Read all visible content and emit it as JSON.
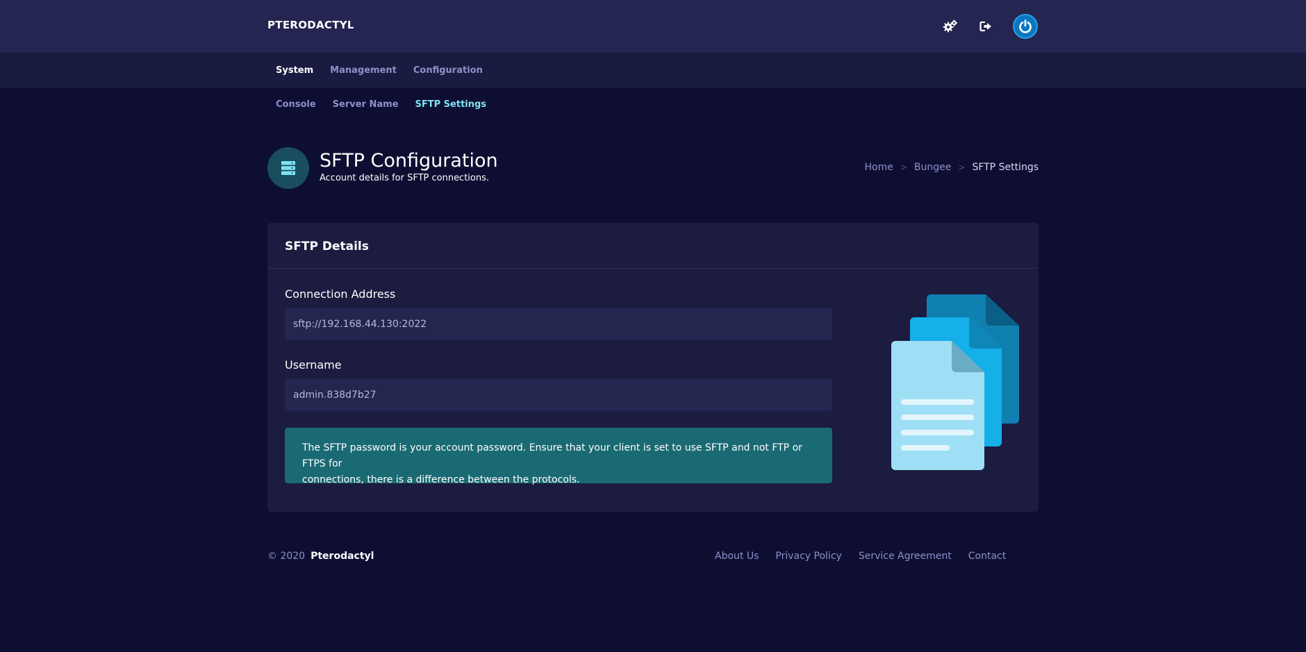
{
  "topbar": {
    "brand": "PTERODACTYL",
    "icons": [
      "cogs-icon",
      "sign-out-icon",
      "power-icon"
    ]
  },
  "main_nav": {
    "items": [
      {
        "label": "System",
        "active": true
      },
      {
        "label": "Management",
        "active": false
      },
      {
        "label": "Configuration",
        "active": false
      }
    ]
  },
  "sub_nav": {
    "items": [
      {
        "label": "Console",
        "active": false
      },
      {
        "label": "Server Name",
        "active": false
      },
      {
        "label": "SFTP Settings",
        "active": true
      }
    ]
  },
  "header": {
    "icon": "server-stack-icon",
    "title": "SFTP Configuration",
    "subtitle": "Account details for SFTP connections.",
    "breadcrumb": [
      "Home",
      "Bungee",
      "SFTP Settings"
    ]
  },
  "card": {
    "title": "SFTP Details",
    "connection": {
      "label": "Connection Address",
      "value": "sftp://192.168.44.130:2022"
    },
    "username": {
      "label": "Username",
      "value": "admin.838d7b27"
    },
    "alert_line1": "The SFTP password is your account password. Ensure that your client is set to use SFTP and not FTP or FTPS for",
    "alert_line2": "connections, there is a difference between the protocols.",
    "illustration": "files-icon"
  },
  "footer": {
    "copyright": "© 2020",
    "brand": "Pterodactyl",
    "links": [
      "About Us",
      "Privacy Policy",
      "Service Agreement",
      "Contact"
    ]
  },
  "colors": {
    "background": "#0e0e32",
    "topbar": "#242550",
    "nav": "#1a1b40",
    "card": "#1b1c40",
    "input": "#252650",
    "alert": "#1a6a74",
    "accent": "#7fe3f0",
    "muted_text": "#8e91c9"
  }
}
